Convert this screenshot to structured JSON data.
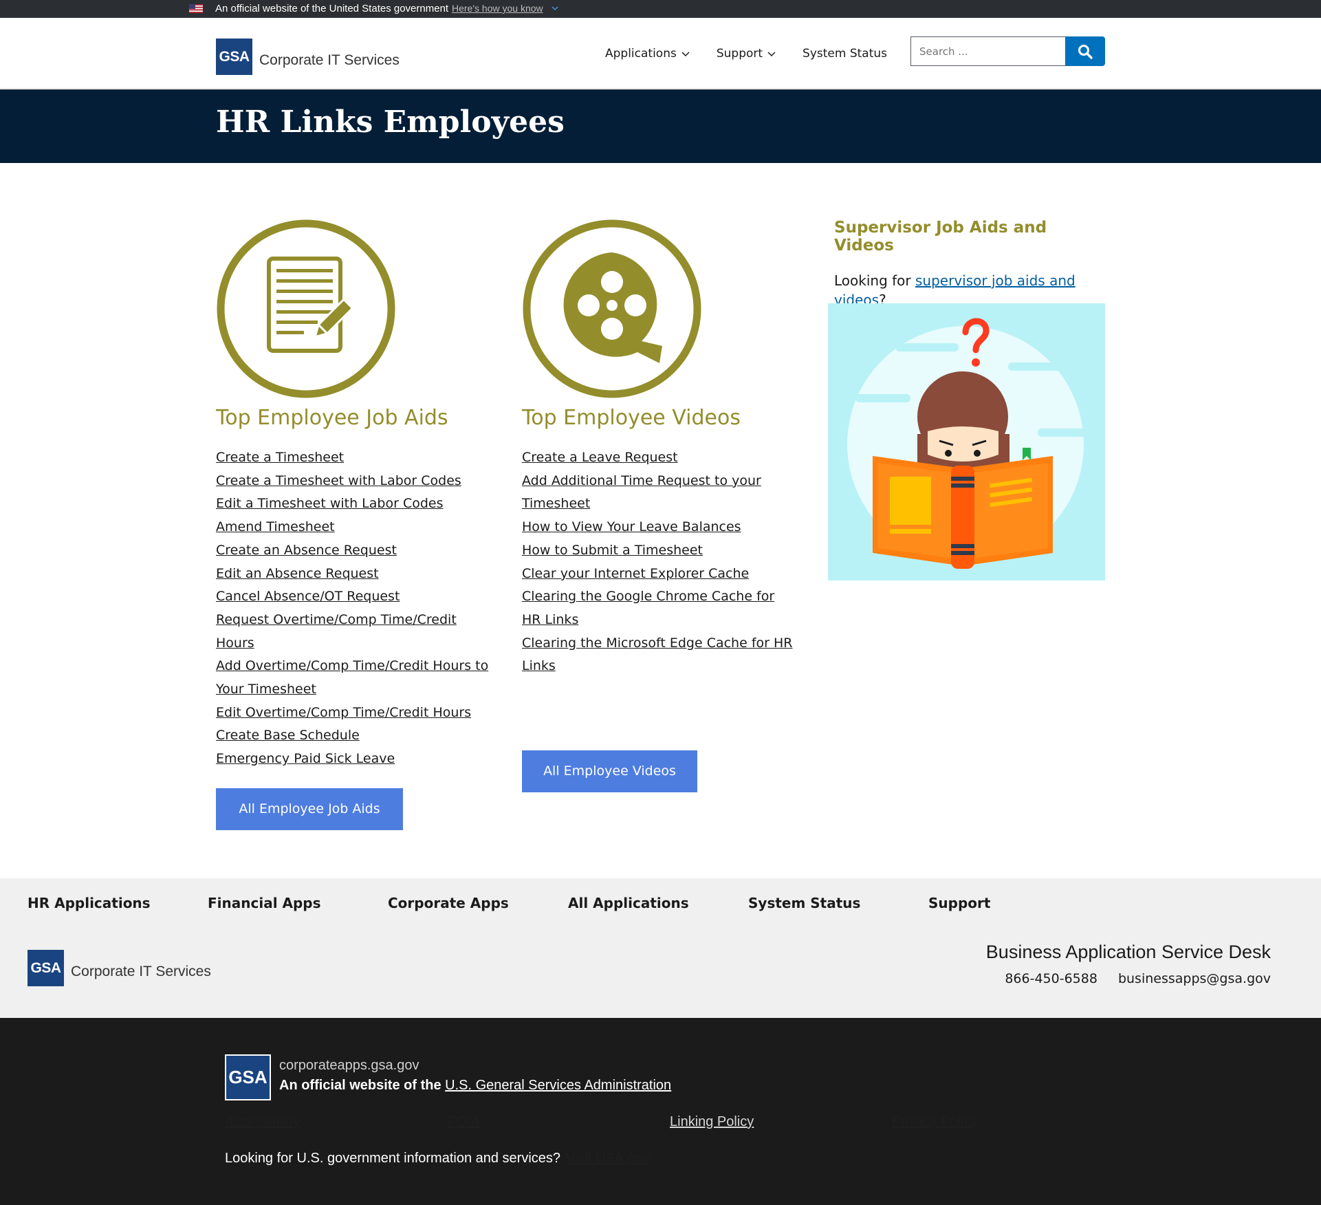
{
  "banner": {
    "text": "An official website of the United States government",
    "how_link": "Here's how you know"
  },
  "header": {
    "logo_box": "GSA",
    "logo_text": "Corporate IT Services",
    "nav": [
      {
        "label": "Applications",
        "dropdown": true
      },
      {
        "label": "Support",
        "dropdown": true
      },
      {
        "label": "System Status",
        "dropdown": false
      }
    ],
    "search_placeholder": "Search ..."
  },
  "hero": {
    "title": "HR Links Employees"
  },
  "job_aids": {
    "title": "Top Employee Job Aids",
    "icon": "document-pencil-icon",
    "links": [
      "Create a Timesheet",
      "Create a Timesheet with Labor Codes",
      "Edit a Timesheet with Labor Codes",
      "Amend Timesheet",
      "Create an Absence Request",
      "Edit an Absence Request",
      "Cancel Absence/OT Request",
      "Request Overtime/Comp Time/Credit Hours",
      "Add Overtime/Comp Time/Credit Hours to Your Timesheet",
      "Edit Overtime/Comp Time/Credit Hours",
      "Create Base Schedule",
      "Emergency Paid Sick Leave"
    ],
    "button": "All Employee Job Aids"
  },
  "videos": {
    "title": "Top Employee Videos",
    "icon": "film-reel-icon",
    "links": [
      "Create a Leave Request",
      "Add Additional Time Request to your Timesheet",
      "How to View Your Leave Balances",
      "How to Submit a Timesheet",
      "Clear your Internet Explorer Cache",
      "Clearing the Google Chrome Cache for HR Links",
      "Clearing the Microsoft Edge Cache for HR Links"
    ],
    "button": "All Employee Videos"
  },
  "sidebar": {
    "title": "Supervisor Job Aids and Videos",
    "text_before": "Looking for ",
    "link": "supervisor job aids and videos",
    "text_after": "?"
  },
  "footer": {
    "nav": [
      "HR Applications",
      "Financial Apps",
      "Corporate Apps",
      "All Applications",
      "System Status",
      "Support"
    ],
    "logo_box": "GSA",
    "logo_text": "Corporate IT Services",
    "desk_title": "Business Application Service Desk",
    "phone": "866-450-6588",
    "email": "businessapps@gsa.gov"
  },
  "identifier": {
    "box": "GSA",
    "domain": "corporateapps.gsa.gov",
    "official_prefix": "An official website of the",
    "agency_link": "U.S. General Services Administration",
    "links": [
      "Accessibility",
      "FOIA",
      "Linking Policy",
      "Privacy Policy"
    ],
    "looking": "Looking for U.S. government information and services?",
    "usagov_link": "Visit USA.gov"
  },
  "colors": {
    "hero_bg": "#041e37",
    "accent_olive": "#938d2c",
    "button_blue": "#4e7de0",
    "search_blue": "#0071bc",
    "gsa_blue": "#1a4480"
  }
}
